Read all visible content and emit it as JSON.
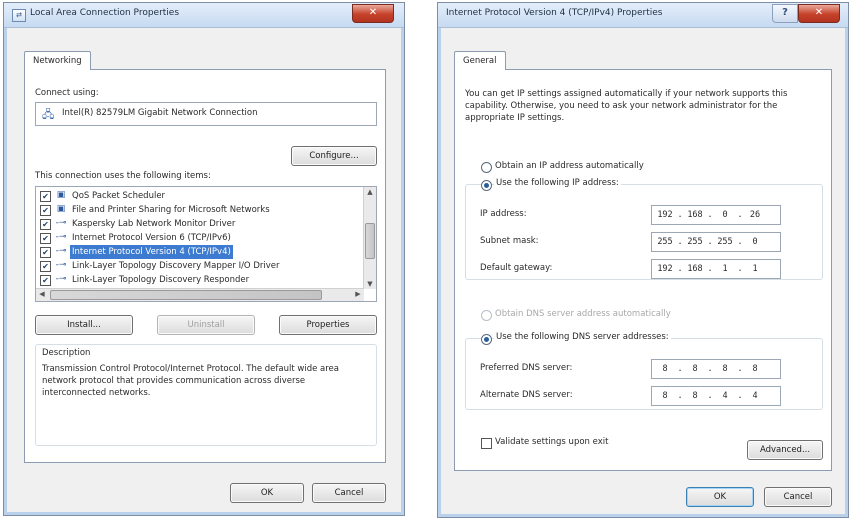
{
  "left_dialog": {
    "title": "Local Area Connection Properties",
    "close_label": "✕",
    "tab_label": "Networking",
    "connect_using_label": "Connect using:",
    "adapter_name": "Intel(R) 82579LM Gigabit Network Connection",
    "configure_label": "Configure...",
    "items_label": "This connection uses the following items:",
    "items": [
      {
        "label": "QoS Packet Scheduler",
        "checked": true,
        "icon": "network-service-icon"
      },
      {
        "label": "File and Printer Sharing for Microsoft Networks",
        "checked": true,
        "icon": "network-service-icon"
      },
      {
        "label": "Kaspersky Lab Network Monitor Driver",
        "checked": true,
        "icon": "protocol-icon"
      },
      {
        "label": "Internet Protocol Version 6 (TCP/IPv6)",
        "checked": true,
        "icon": "protocol-icon"
      },
      {
        "label": "Internet Protocol Version 4 (TCP/IPv4)",
        "checked": true,
        "icon": "protocol-icon",
        "selected": true
      },
      {
        "label": "Link-Layer Topology Discovery Mapper I/O Driver",
        "checked": true,
        "icon": "protocol-icon"
      },
      {
        "label": "Link-Layer Topology Discovery Responder",
        "checked": true,
        "icon": "protocol-icon"
      }
    ],
    "install_label": "Install...",
    "uninstall_label": "Uninstall",
    "properties_label": "Properties",
    "description_heading": "Description",
    "description_text": "Transmission Control Protocol/Internet Protocol. The default wide area network protocol that provides communication across diverse interconnected networks.",
    "ok_label": "OK",
    "cancel_label": "Cancel"
  },
  "right_dialog": {
    "title": "Internet Protocol Version 4 (TCP/IPv4) Properties",
    "help_label": "?",
    "close_label": "✕",
    "tab_label": "General",
    "intro_text": "You can get IP settings assigned automatically if your network supports this capability. Otherwise, you need to ask your network administrator for the appropriate IP settings.",
    "obtain_ip_label": "Obtain an IP address automatically",
    "use_ip_label": "Use the following IP address:",
    "ip_address_label": "IP address:",
    "ip_address": [
      "192",
      "168",
      "0",
      "26"
    ],
    "subnet_label": "Subnet mask:",
    "subnet_mask": [
      "255",
      "255",
      "255",
      "0"
    ],
    "gateway_label": "Default gateway:",
    "default_gateway": [
      "192",
      "168",
      "1",
      "1"
    ],
    "obtain_dns_label": "Obtain DNS server address automatically",
    "use_dns_label": "Use the following DNS server addresses:",
    "preferred_dns_label": "Preferred DNS server:",
    "preferred_dns": [
      "8",
      "8",
      "8",
      "8"
    ],
    "alternate_dns_label": "Alternate DNS server:",
    "alternate_dns": [
      "8",
      "8",
      "4",
      "4"
    ],
    "validate_label": "Validate settings upon exit",
    "advanced_label": "Advanced...",
    "ok_label": "OK",
    "cancel_label": "Cancel"
  }
}
